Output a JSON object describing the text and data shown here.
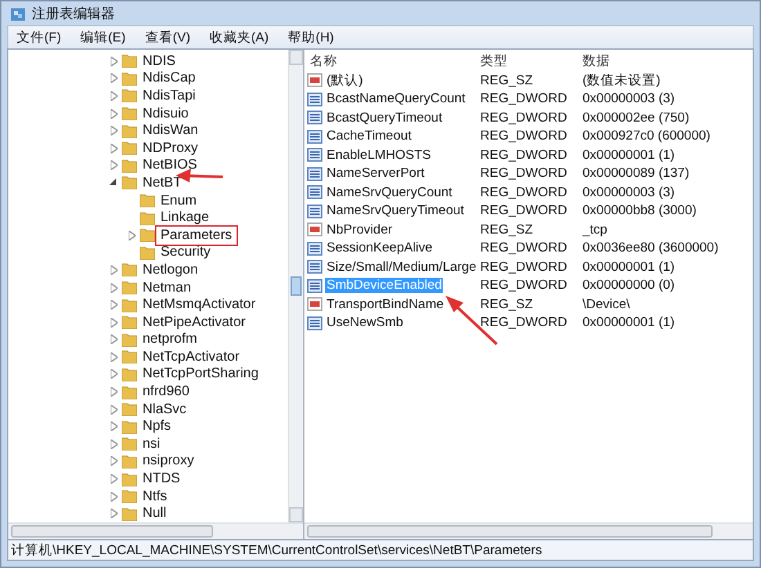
{
  "window": {
    "title": "注册表编辑器"
  },
  "menu": [
    "文件(F)",
    "编辑(E)",
    "查看(V)",
    "收藏夹(A)",
    "帮助(H)"
  ],
  "tree": {
    "items": [
      {
        "label": "NDIS",
        "kind": "collapsed",
        "selected": false
      },
      {
        "label": "NdisCap",
        "kind": "collapsed",
        "selected": false
      },
      {
        "label": "NdisTapi",
        "kind": "collapsed",
        "selected": false
      },
      {
        "label": "Ndisuio",
        "kind": "collapsed",
        "selected": false
      },
      {
        "label": "NdisWan",
        "kind": "collapsed",
        "selected": false
      },
      {
        "label": "NDProxy",
        "kind": "collapsed",
        "selected": false
      },
      {
        "label": "NetBIOS",
        "kind": "collapsed",
        "selected": false
      },
      {
        "label": "NetBT",
        "kind": "expanded",
        "selected": false,
        "children": [
          {
            "label": "Enum",
            "kind": "leaf",
            "selected": false
          },
          {
            "label": "Linkage",
            "kind": "leaf",
            "selected": false
          },
          {
            "label": "Parameters",
            "kind": "collapsed",
            "selected": true
          },
          {
            "label": "Security",
            "kind": "leaf",
            "selected": false
          }
        ]
      },
      {
        "label": "Netlogon",
        "kind": "collapsed",
        "selected": false
      },
      {
        "label": "Netman",
        "kind": "collapsed",
        "selected": false
      },
      {
        "label": "NetMsmqActivator",
        "kind": "collapsed",
        "selected": false
      },
      {
        "label": "NetPipeActivator",
        "kind": "collapsed",
        "selected": false
      },
      {
        "label": "netprofm",
        "kind": "collapsed",
        "selected": false
      },
      {
        "label": "NetTcpActivator",
        "kind": "collapsed",
        "selected": false
      },
      {
        "label": "NetTcpPortSharing",
        "kind": "collapsed",
        "selected": false
      },
      {
        "label": "nfrd960",
        "kind": "collapsed",
        "selected": false
      },
      {
        "label": "NlaSvc",
        "kind": "collapsed",
        "selected": false
      },
      {
        "label": "Npfs",
        "kind": "collapsed",
        "selected": false
      },
      {
        "label": "nsi",
        "kind": "collapsed",
        "selected": false
      },
      {
        "label": "nsiproxy",
        "kind": "collapsed",
        "selected": false
      },
      {
        "label": "NTDS",
        "kind": "collapsed",
        "selected": false
      },
      {
        "label": "Ntfs",
        "kind": "collapsed",
        "selected": false
      },
      {
        "label": "Null",
        "kind": "collapsed",
        "selected": false
      }
    ]
  },
  "table": {
    "columns": [
      "名称",
      "类型",
      "数据"
    ],
    "rows": [
      {
        "name": "(默认)",
        "type": "REG_SZ",
        "data": "(数值未设置)",
        "kind": "string",
        "selected": false
      },
      {
        "name": "BcastNameQueryCount",
        "type": "REG_DWORD",
        "data": "0x00000003 (3)",
        "kind": "binary",
        "selected": false
      },
      {
        "name": "BcastQueryTimeout",
        "type": "REG_DWORD",
        "data": "0x000002ee (750)",
        "kind": "binary",
        "selected": false
      },
      {
        "name": "CacheTimeout",
        "type": "REG_DWORD",
        "data": "0x000927c0 (600000)",
        "kind": "binary",
        "selected": false
      },
      {
        "name": "EnableLMHOSTS",
        "type": "REG_DWORD",
        "data": "0x00000001 (1)",
        "kind": "binary",
        "selected": false
      },
      {
        "name": "NameServerPort",
        "type": "REG_DWORD",
        "data": "0x00000089 (137)",
        "kind": "binary",
        "selected": false
      },
      {
        "name": "NameSrvQueryCount",
        "type": "REG_DWORD",
        "data": "0x00000003 (3)",
        "kind": "binary",
        "selected": false
      },
      {
        "name": "NameSrvQueryTimeout",
        "type": "REG_DWORD",
        "data": "0x00000bb8 (3000)",
        "kind": "binary",
        "selected": false
      },
      {
        "name": "NbProvider",
        "type": "REG_SZ",
        "data": "_tcp",
        "kind": "string",
        "selected": false
      },
      {
        "name": "SessionKeepAlive",
        "type": "REG_DWORD",
        "data": "0x0036ee80 (3600000)",
        "kind": "binary",
        "selected": false
      },
      {
        "name": "Size/Small/Medium/Large",
        "type": "REG_DWORD",
        "data": "0x00000001 (1)",
        "kind": "binary",
        "selected": false
      },
      {
        "name": "SmbDeviceEnabled",
        "type": "REG_DWORD",
        "data": "0x00000000 (0)",
        "kind": "binary",
        "selected": true
      },
      {
        "name": "TransportBindName",
        "type": "REG_SZ",
        "data": "\\Device\\",
        "kind": "string",
        "selected": false
      },
      {
        "name": "UseNewSmb",
        "type": "REG_DWORD",
        "data": "0x00000001 (1)",
        "kind": "binary",
        "selected": false
      }
    ]
  },
  "status_bar": "计算机\\HKEY_LOCAL_MACHINE\\SYSTEM\\CurrentControlSet\\services\\NetBT\\Parameters"
}
